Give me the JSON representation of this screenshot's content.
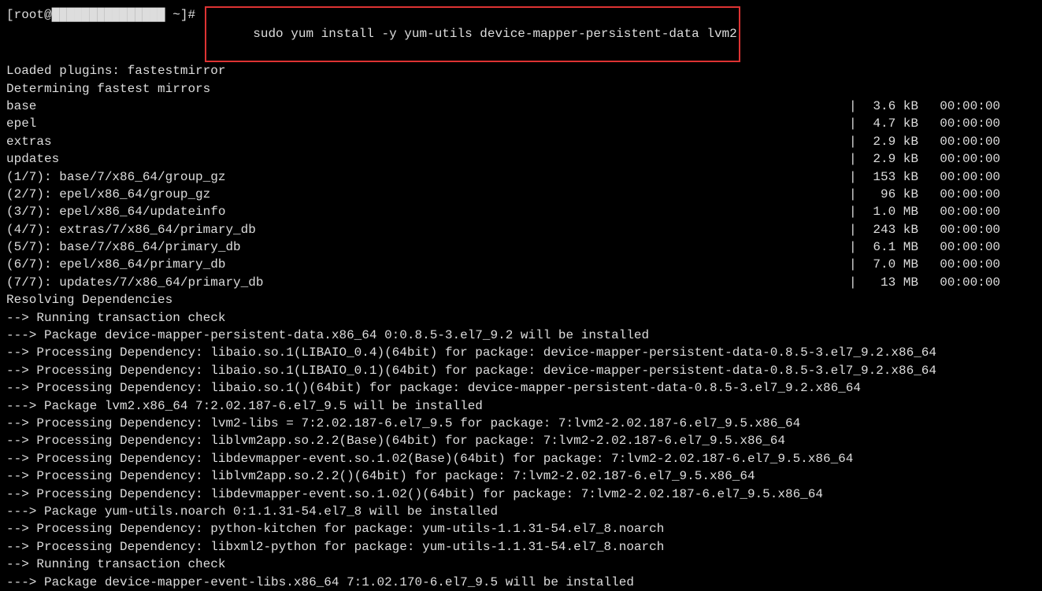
{
  "prompt": {
    "user": "root",
    "host_redacted": "███████████████",
    "dir": "~",
    "symbol": "#",
    "command": "sudo yum install -y yum-utils device-mapper-persistent-data lvm2"
  },
  "header_lines": [
    "Loaded plugins: fastestmirror",
    "Determining fastest mirrors"
  ],
  "repos": [
    {
      "name": "base",
      "size": "3.6 kB",
      "time": "00:00:00"
    },
    {
      "name": "epel",
      "size": "4.7 kB",
      "time": "00:00:00"
    },
    {
      "name": "extras",
      "size": "2.9 kB",
      "time": "00:00:00"
    },
    {
      "name": "updates",
      "size": "2.9 kB",
      "time": "00:00:00"
    }
  ],
  "downloads": [
    {
      "name": "(1/7): base/7/x86_64/group_gz",
      "size": "153 kB",
      "time": "00:00:00"
    },
    {
      "name": "(2/7): epel/x86_64/group_gz",
      "size": "96 kB",
      "time": "00:00:00"
    },
    {
      "name": "(3/7): epel/x86_64/updateinfo",
      "size": "1.0 MB",
      "time": "00:00:00"
    },
    {
      "name": "(4/7): extras/7/x86_64/primary_db",
      "size": "243 kB",
      "time": "00:00:00"
    },
    {
      "name": "(5/7): base/7/x86_64/primary_db",
      "size": "6.1 MB",
      "time": "00:00:00"
    },
    {
      "name": "(6/7): epel/x86_64/primary_db",
      "size": "7.0 MB",
      "time": "00:00:00"
    },
    {
      "name": "(7/7): updates/7/x86_64/primary_db",
      "size": "13 MB",
      "time": "00:00:00"
    }
  ],
  "resolving": "Resolving Dependencies",
  "dep_lines": [
    "--> Running transaction check",
    "---> Package device-mapper-persistent-data.x86_64 0:0.8.5-3.el7_9.2 will be installed",
    "--> Processing Dependency: libaio.so.1(LIBAIO_0.4)(64bit) for package: device-mapper-persistent-data-0.8.5-3.el7_9.2.x86_64",
    "--> Processing Dependency: libaio.so.1(LIBAIO_0.1)(64bit) for package: device-mapper-persistent-data-0.8.5-3.el7_9.2.x86_64",
    "--> Processing Dependency: libaio.so.1()(64bit) for package: device-mapper-persistent-data-0.8.5-3.el7_9.2.x86_64",
    "---> Package lvm2.x86_64 7:2.02.187-6.el7_9.5 will be installed",
    "--> Processing Dependency: lvm2-libs = 7:2.02.187-6.el7_9.5 for package: 7:lvm2-2.02.187-6.el7_9.5.x86_64",
    "--> Processing Dependency: liblvm2app.so.2.2(Base)(64bit) for package: 7:lvm2-2.02.187-6.el7_9.5.x86_64",
    "--> Processing Dependency: libdevmapper-event.so.1.02(Base)(64bit) for package: 7:lvm2-2.02.187-6.el7_9.5.x86_64",
    "--> Processing Dependency: liblvm2app.so.2.2()(64bit) for package: 7:lvm2-2.02.187-6.el7_9.5.x86_64",
    "--> Processing Dependency: libdevmapper-event.so.1.02()(64bit) for package: 7:lvm2-2.02.187-6.el7_9.5.x86_64",
    "---> Package yum-utils.noarch 0:1.1.31-54.el7_8 will be installed",
    "--> Processing Dependency: python-kitchen for package: yum-utils-1.1.31-54.el7_8.noarch",
    "--> Processing Dependency: libxml2-python for package: yum-utils-1.1.31-54.el7_8.noarch",
    "--> Running transaction check",
    "---> Package device-mapper-event-libs.x86_64 7:1.02.170-6.el7_9.5 will be installed"
  ]
}
